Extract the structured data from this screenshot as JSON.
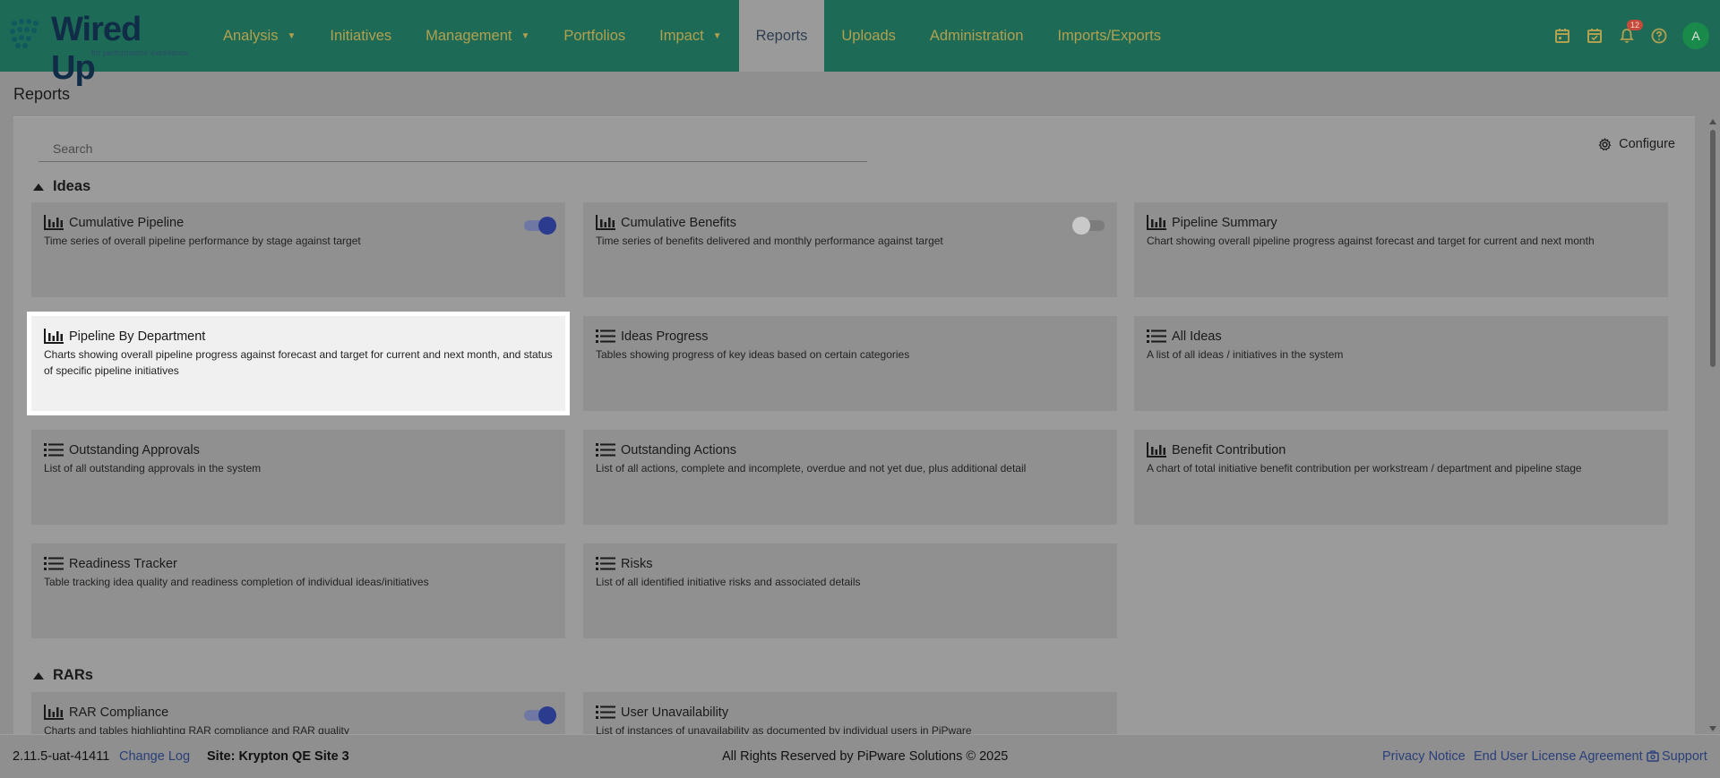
{
  "header": {
    "logo_text": "Wired Up",
    "logo_sub": "for performance excellence",
    "nav": [
      {
        "label": "Analysis",
        "dropdown": true
      },
      {
        "label": "Initiatives",
        "dropdown": false
      },
      {
        "label": "Management",
        "dropdown": true
      },
      {
        "label": "Portfolios",
        "dropdown": false
      },
      {
        "label": "Impact",
        "dropdown": true
      },
      {
        "label": "Reports",
        "dropdown": false,
        "active": true
      },
      {
        "label": "Uploads",
        "dropdown": false
      },
      {
        "label": "Administration",
        "dropdown": false
      },
      {
        "label": "Imports/Exports",
        "dropdown": false
      }
    ],
    "icons": [
      "calendar-icon",
      "calendar-check-icon",
      "bell-icon",
      "help-icon"
    ],
    "notification_count": "12",
    "avatar_initial": "A"
  },
  "page": {
    "title": "Reports",
    "search_placeholder": "Search",
    "configure_label": "Configure"
  },
  "sections": {
    "ideas": {
      "title": "Ideas",
      "cards": [
        {
          "icon": "bar-chart-icon",
          "title": "Cumulative Pipeline",
          "desc": "Time series of overall pipeline performance by stage against target",
          "toggle": "on"
        },
        {
          "icon": "bar-chart-icon",
          "title": "Cumulative Benefits",
          "desc": "Time series of benefits delivered and monthly performance against target",
          "toggle": "off"
        },
        {
          "icon": "bar-chart-icon",
          "title": "Pipeline Summary",
          "desc": "Chart showing overall pipeline progress against forecast and target for current and next month"
        },
        {
          "icon": "bar-chart-icon",
          "title": "Pipeline By Department",
          "desc": "Charts showing overall pipeline progress against forecast and target for current and next month, and status of specific pipeline initiatives",
          "highlight": true
        },
        {
          "icon": "list-icon",
          "title": "Ideas Progress",
          "desc": "Tables showing progress of key ideas based on certain categories"
        },
        {
          "icon": "list-icon",
          "title": "All Ideas",
          "desc": "A list of all ideas / initiatives in the system"
        },
        {
          "icon": "list-icon",
          "title": "Outstanding Approvals",
          "desc": "List of all outstanding approvals in the system"
        },
        {
          "icon": "list-icon",
          "title": "Outstanding Actions",
          "desc": "List of all actions, complete and incomplete, overdue and not yet due, plus additional detail"
        },
        {
          "icon": "bar-chart-icon",
          "title": "Benefit Contribution",
          "desc": "A chart of total initiative benefit contribution per workstream / department and pipeline stage"
        },
        {
          "icon": "list-icon",
          "title": "Readiness Tracker",
          "desc": "Table tracking idea quality and readiness completion of individual ideas/initiatives"
        },
        {
          "icon": "list-icon",
          "title": "Risks",
          "desc": "List of all identified initiative risks and associated details"
        }
      ]
    },
    "rars": {
      "title": "RARs",
      "cards": [
        {
          "icon": "bar-chart-icon",
          "title": "RAR Compliance",
          "desc": "Charts and tables highlighting RAR compliance and RAR quality",
          "toggle": "on"
        },
        {
          "icon": "list-icon",
          "title": "User Unavailability",
          "desc": "List of instances of unavailability as documented by individual users in PiPware"
        }
      ]
    }
  },
  "footer": {
    "version": "2.11.5-uat-41411",
    "change_log": "Change Log",
    "site": "Site: Krypton QE Site 3",
    "rights": "All Rights Reserved by PiPware Solutions © 2025",
    "privacy": "Privacy Notice",
    "eula": "End User License Agreement",
    "support": "Support"
  },
  "colors": {
    "header_bg": "#1d6b57",
    "nav_text": "#b0a050",
    "toggle_on": "#2b3c8f",
    "link": "#2a3f7a"
  }
}
